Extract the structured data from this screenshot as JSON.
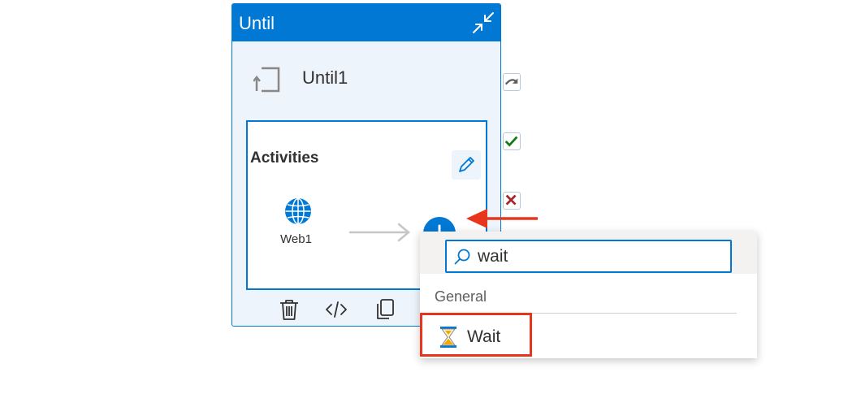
{
  "until_card": {
    "title": "Until",
    "activity_name": "Until1",
    "activities_label": "Activities",
    "inner_activity_label": "Web1"
  },
  "dropdown": {
    "search_value": "wait",
    "group_label": "General",
    "item_label": "Wait"
  },
  "icons": {
    "collapse": "collapse-arrows-icon",
    "loop": "loop-until-icon",
    "edit": "pencil-icon",
    "web": "globe-icon",
    "add": "plus-icon",
    "delete": "trash-icon",
    "code": "code-icon",
    "copy": "copy-icon",
    "skip": "redo-arrow-icon",
    "success": "checkmark-icon",
    "failure": "x-icon",
    "search": "search-icon",
    "wait": "hourglass-icon"
  },
  "colors": {
    "accent": "#0078d4",
    "highlight": "#e8361c",
    "success": "#107c10",
    "failure": "#a4262c"
  }
}
